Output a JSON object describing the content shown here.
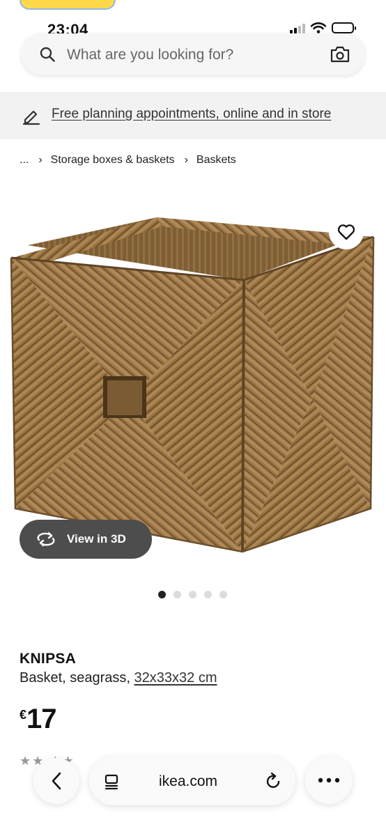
{
  "status": {
    "time": "23:04"
  },
  "search": {
    "placeholder": "What are you looking for?"
  },
  "planning_banner": {
    "link_text": "Free planning appointments, online and in store"
  },
  "breadcrumb": {
    "ellipsis": "...",
    "items": [
      "Storage boxes & baskets",
      "Baskets"
    ]
  },
  "gallery": {
    "view_3d_label": "View in 3D",
    "image_count": 5,
    "active_index": 0
  },
  "product": {
    "name": "KNIPSA",
    "description": "Basket, seagrass,",
    "dimensions": "32x33x32 cm",
    "currency": "€",
    "price": "17"
  },
  "browser": {
    "url": "ikea.com"
  },
  "colors": {
    "banner_bg": "#f2f2f2",
    "view3d_bg": "#4d4d4d",
    "basket": "#9a7446"
  }
}
